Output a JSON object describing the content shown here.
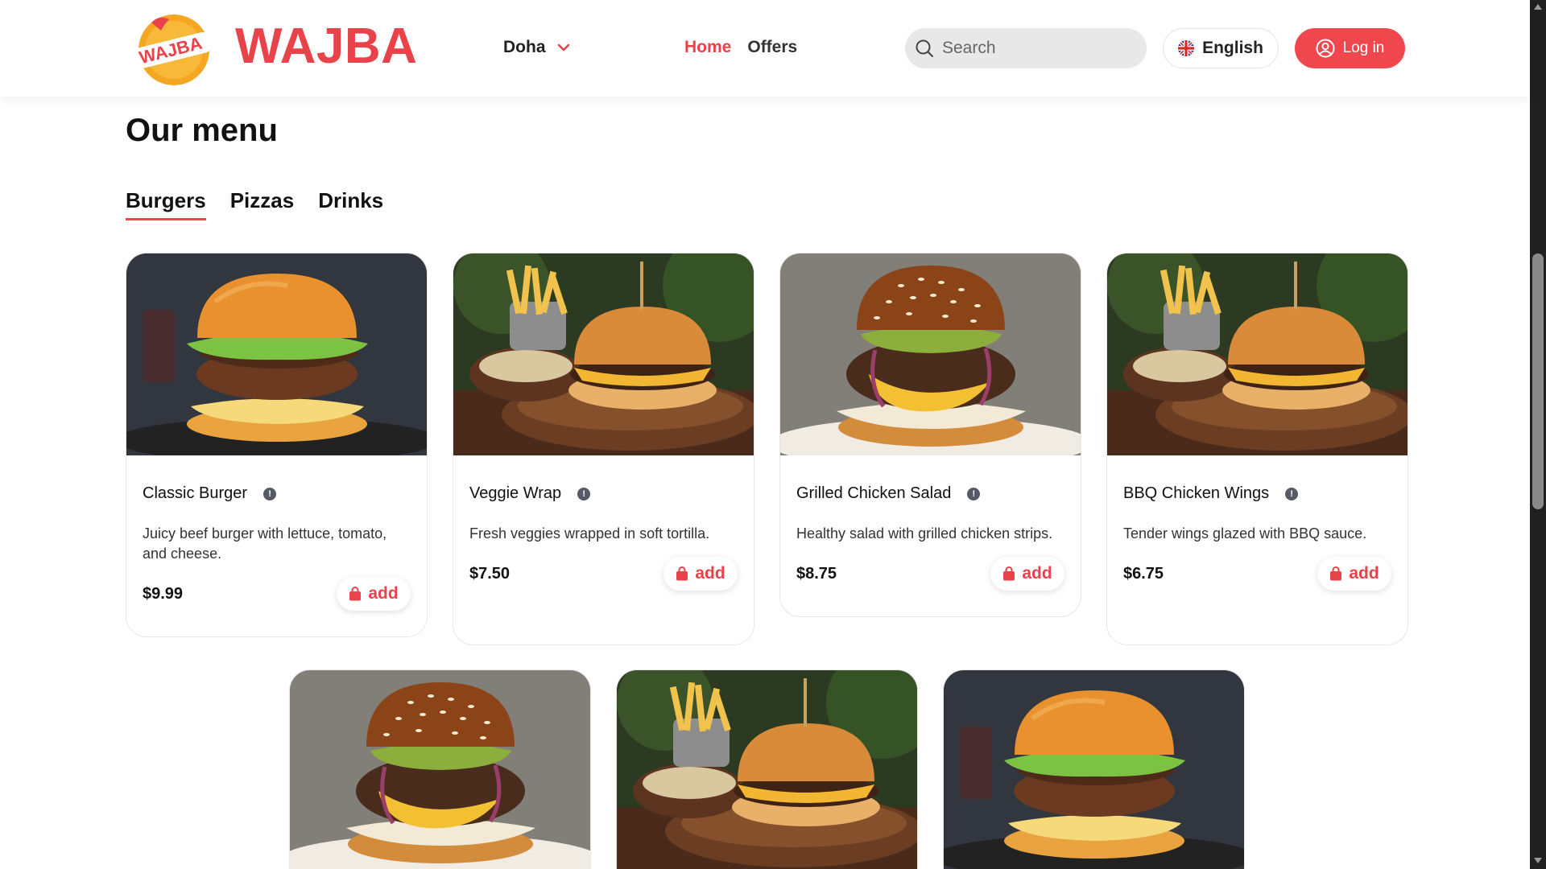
{
  "header": {
    "brand": "WAJBA",
    "logo_text": "WAJBA",
    "city": "Doha",
    "nav": [
      {
        "label": "Home",
        "active": true
      },
      {
        "label": "Offers",
        "active": false
      }
    ],
    "search_placeholder": "Search",
    "language": "English",
    "login_label": "Log in"
  },
  "menu": {
    "title": "Our menu",
    "tabs": [
      {
        "label": "Burgers",
        "active": true
      },
      {
        "label": "Pizzas",
        "active": false
      },
      {
        "label": "Drinks",
        "active": false
      }
    ],
    "add_label": "add",
    "items": [
      {
        "name": "Classic Burger",
        "description": "Juicy beef burger with lettuce, tomato, and cheese.",
        "price": "$9.99",
        "image": "burger-dark"
      },
      {
        "name": "Veggie Wrap",
        "description": "Fresh veggies wrapped in soft tortilla.",
        "price": "$7.50",
        "image": "burger-fries"
      },
      {
        "name": "Grilled Chicken Salad",
        "description": "Healthy salad with grilled chicken strips.",
        "price": "$8.75",
        "image": "burger-sesame"
      },
      {
        "name": "BBQ Chicken Wings",
        "description": "Tender wings glazed with BBQ sauce.",
        "price": "$6.75",
        "image": "burger-fries"
      }
    ],
    "second_row_images": [
      "burger-sesame",
      "burger-fries",
      "burger-dark"
    ]
  },
  "colors": {
    "accent": "#ef474d",
    "brand": "#e8434a"
  },
  "icons": [
    "logo-badge-icon",
    "chevron-down-icon",
    "search-icon",
    "uk-flag-icon",
    "user-circle-icon",
    "info-icon",
    "shopping-bag-icon"
  ]
}
